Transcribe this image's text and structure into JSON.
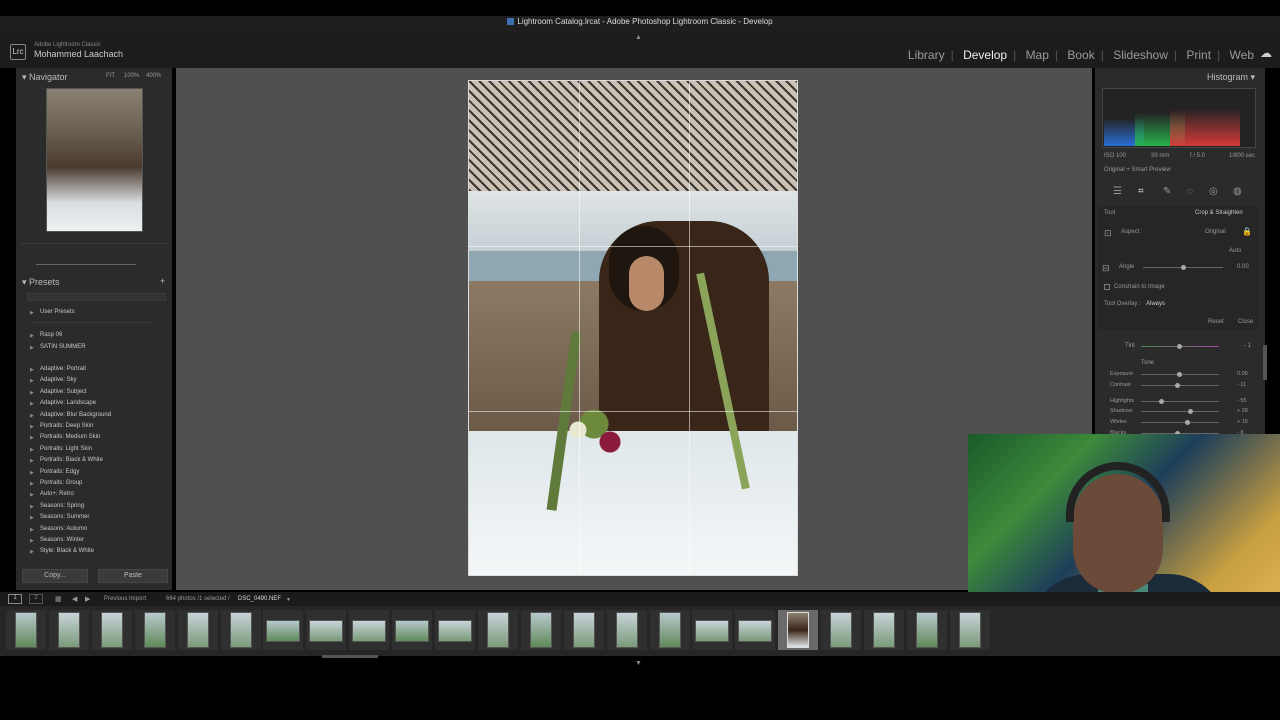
{
  "window": {
    "title": "Lightroom Catalog.lrcat - Adobe Photoshop Lightroom Classic - Develop"
  },
  "identity": {
    "subtitle": "Adobe Lightroom Classic",
    "name": "Mohammed Laachach",
    "logo": "Lrc"
  },
  "modules": {
    "items": [
      "Library",
      "Develop",
      "Map",
      "Book",
      "Slideshow",
      "Print",
      "Web"
    ],
    "active": "Develop"
  },
  "navigator": {
    "title": "Navigator",
    "zoom_fit": "FIT",
    "zoom_100": "100%",
    "zoom_400": "400%"
  },
  "presets": {
    "title": "Presets",
    "add": "+",
    "groups": [
      "User Presets",
      "Rasp 06",
      "SATIN SUMMER"
    ],
    "items": [
      "Adaptive: Portrait",
      "Adaptive: Sky",
      "Adaptive: Subject",
      "Adaptive: Landscape",
      "Adaptive: Blur Background",
      "Portraits: Deep Skin",
      "Portraits: Medium Skin",
      "Portraits: Light Skin",
      "Portraits: Black & White",
      "Portraits: Edgy",
      "Portraits: Group",
      "Auto+: Retro",
      "Seasons: Spring",
      "Seasons: Summer",
      "Seasons: Autumn",
      "Seasons: Winter",
      "Style: Black & White"
    ]
  },
  "left_buttons": {
    "copy": "Copy...",
    "paste": "Paste"
  },
  "histogram": {
    "title": "Histogram",
    "iso": "ISO 100",
    "focal": "39 mm",
    "aperture": "f / 5.0",
    "shutter": "1/800 sec",
    "preview_label": "Original + Smart Preview"
  },
  "crop": {
    "tool_label": "Tool",
    "title": "Crop & Straighten",
    "aspect_label": "Aspect :",
    "aspect_value": "Original",
    "auto": "Auto",
    "angle_label": "Angle",
    "angle_value": "0.00",
    "constrain": "Constrain to Image",
    "overlay_label": "Tool Overlay :",
    "overlay_value": "Always",
    "reset": "Reset",
    "close": "Close"
  },
  "basic": {
    "tint_label": "Tint",
    "tint_value": "- 1",
    "tone_label": "Tone",
    "sliders": [
      {
        "label": "Exposure",
        "value": "0.00"
      },
      {
        "label": "Contrast",
        "value": "- 11"
      },
      {
        "label": "Highlights",
        "value": "- 55"
      },
      {
        "label": "Shadows",
        "value": "+ 28"
      },
      {
        "label": "Whites",
        "value": "+ 15"
      },
      {
        "label": "Blacks",
        "value": "- 8"
      }
    ]
  },
  "filmstrip": {
    "page1": "1",
    "page2": "2",
    "source": "Previous Import",
    "count": "664 photos /1 selected /",
    "filename": "DSC_0490.NEF",
    "dropdown": "▾"
  },
  "icons": {
    "apple": "apple-icon",
    "cloud": "cloud-icon",
    "lock": "lock-icon",
    "crop": "crop-icon"
  }
}
